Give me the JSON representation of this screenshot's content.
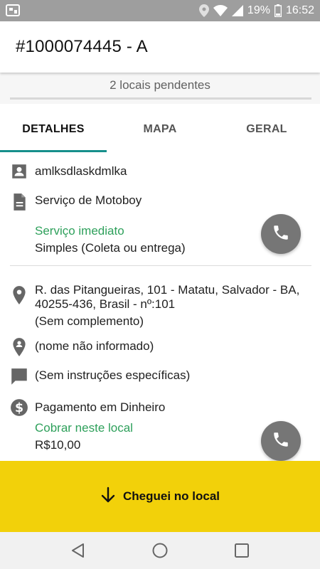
{
  "status_bar": {
    "battery": "19%",
    "time": "16:52"
  },
  "header": {
    "title": "#1000074445 - A"
  },
  "pending": {
    "text": "2 locais pendentes"
  },
  "tabs": [
    {
      "label": "DETALHES",
      "active": true
    },
    {
      "label": "MAPA",
      "active": false
    },
    {
      "label": "GERAL",
      "active": false
    }
  ],
  "client": {
    "name": "amlksdlaskdmlka"
  },
  "service": {
    "type": "Serviço de Motoboy",
    "mode": "Serviço imediato",
    "detail": "Simples (Coleta ou entrega)"
  },
  "location": {
    "address_line1": "R. das Pitangueiras, 101 - Matatu, Salvador - BA,",
    "address_line2": "40255-436, Brasil - nº:101",
    "complement": "(Sem complemento)",
    "contact_name": "(nome não informado)",
    "instructions": "(Sem instruções específicas)",
    "payment_method": "Pagamento em Dinheiro",
    "charge_label": "Cobrar neste local",
    "charge_value": "R$10,00"
  },
  "action": {
    "label": "Cheguei no local"
  },
  "colors": {
    "accent_teal": "#168f8b",
    "green_text": "#2ea05b",
    "action_yellow": "#f2d10a",
    "call_button": "#767676"
  }
}
